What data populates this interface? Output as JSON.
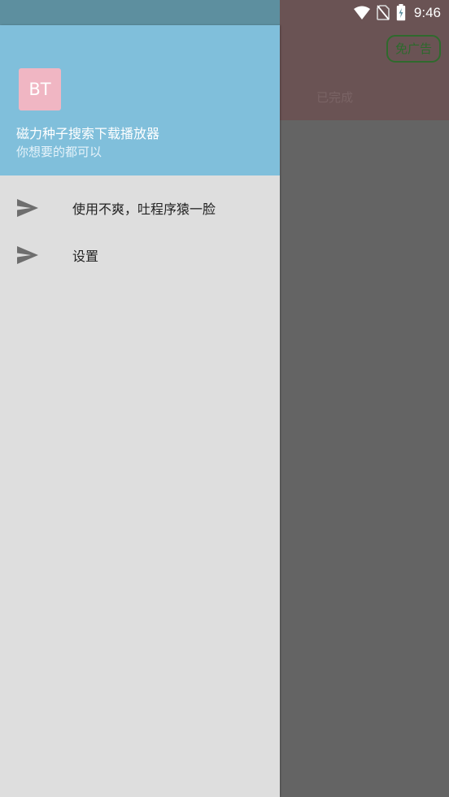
{
  "status_bar": {
    "time": "9:46",
    "icons": [
      "wifi-icon",
      "no-sim-icon",
      "battery-charging-icon"
    ]
  },
  "background_app": {
    "ad_free_button_label": "免广告",
    "tab_label": "已完成"
  },
  "drawer": {
    "header": {
      "logo_text": "BT",
      "app_name": "磁力种子搜索下载播放器",
      "tagline": "你想要的都可以"
    },
    "menu_items": [
      {
        "label": "使用不爽，吐程序猿一脸",
        "icon": "send-icon"
      },
      {
        "label": "设置",
        "icon": "send-icon"
      }
    ]
  },
  "colors": {
    "drawer_header": "#80bfdb",
    "drawer_body": "#dedede",
    "scrim": "#646464",
    "logo_bg": "#f0b6c3",
    "ad_button": "#2c6a2c"
  }
}
